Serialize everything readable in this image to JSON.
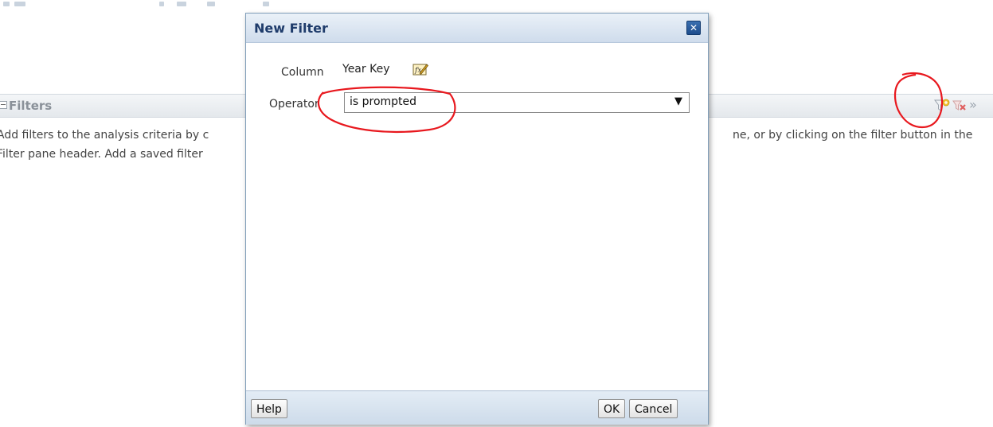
{
  "filters_pane": {
    "title": "Filters",
    "description_line1": "Add filters to the analysis criteria by c",
    "description_line1_end": "ne, or by clicking on the filter button in the",
    "description_line2": "Filter pane header. Add a saved filter"
  },
  "dialog": {
    "title": "New Filter",
    "column_label": "Column",
    "column_value": "Year Key",
    "operator_label": "Operator",
    "operator_value": "is prompted",
    "close_glyph": "✕",
    "buttons": {
      "help": "Help",
      "ok": "OK",
      "cancel": "Cancel"
    }
  },
  "icons": {
    "add_filter": "add-filter-icon",
    "delete_filter": "delete-filter-icon",
    "expand": "»",
    "edit_formula": "edit-formula-icon",
    "dropdown_arrow": "▼"
  },
  "colors": {
    "annotation": "#e8181e",
    "dialog_title": "#1f3c6b",
    "close_button": "#1d4c8c"
  }
}
